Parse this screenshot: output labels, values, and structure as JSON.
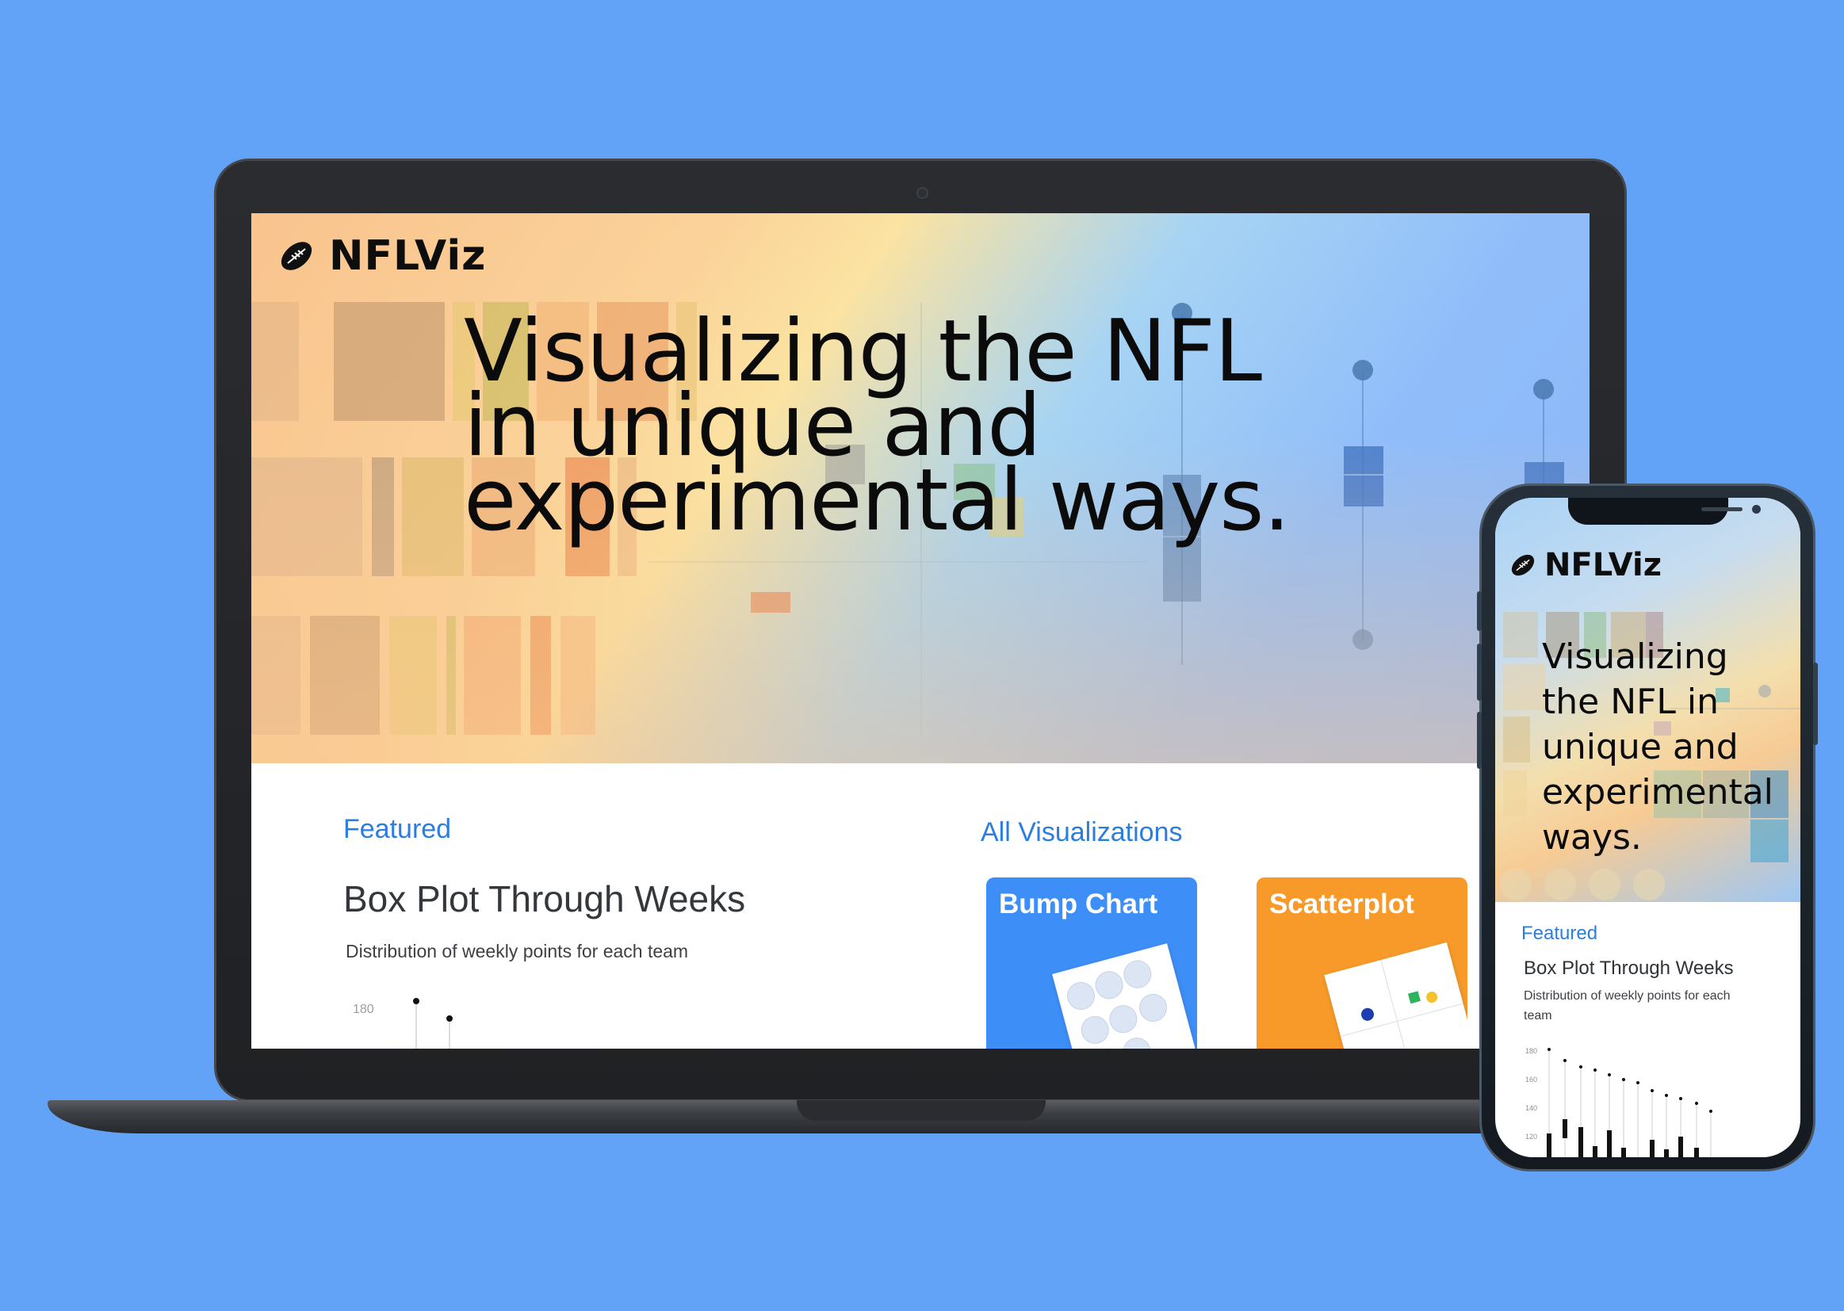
{
  "brand": {
    "name": "NFLViz"
  },
  "hero": {
    "lines": [
      "Visualizing the NFL",
      "in unique and",
      "experimental ways."
    ],
    "mobile_text": "Visualizing the NFL in unique and experimental ways."
  },
  "featured": {
    "heading": "Featured",
    "title": "Box Plot Through Weeks",
    "description": "Distribution of weekly points for each team",
    "axis_tick": "180"
  },
  "all_visualizations": {
    "heading": "All Visualizations",
    "cards": [
      {
        "label": "Bump Chart",
        "color": "#3e8ef7"
      },
      {
        "label": "Scatterplot",
        "color": "#f79a2a"
      }
    ]
  },
  "mobile": {
    "featured_heading": "Featured",
    "title": "Box Plot Through Weeks",
    "description": "Distribution of weekly points for each team",
    "axis_ticks": [
      "180",
      "160",
      "140",
      "120"
    ]
  },
  "colors": {
    "background": "#63a3f7",
    "accent": "#2b7de0"
  },
  "icons": {
    "logo": "football-icon"
  }
}
